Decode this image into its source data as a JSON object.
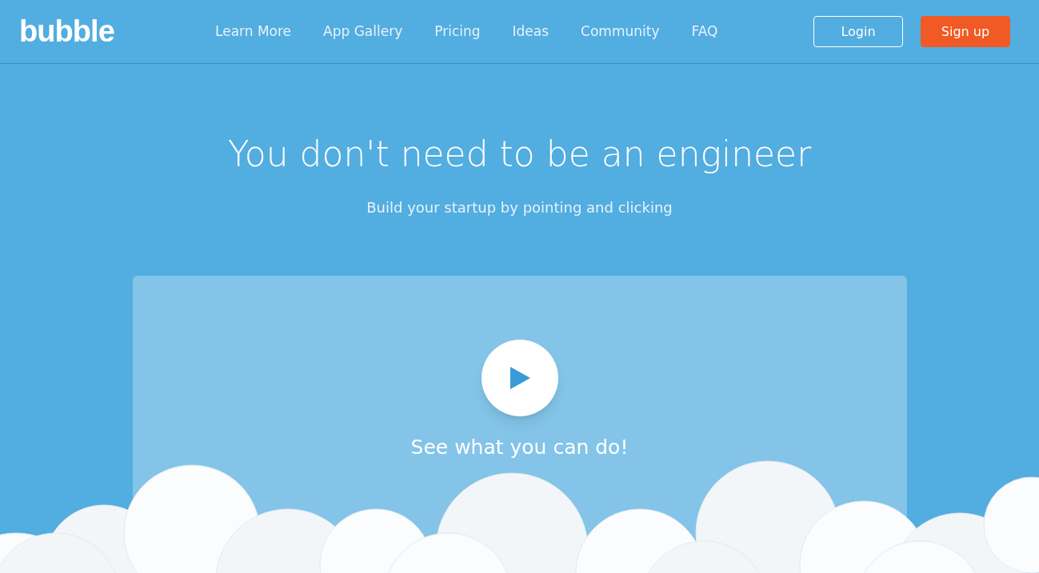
{
  "header": {
    "logo": "bubble",
    "nav": [
      {
        "label": "Learn More"
      },
      {
        "label": "App Gallery"
      },
      {
        "label": "Pricing"
      },
      {
        "label": "Ideas"
      },
      {
        "label": "Community"
      },
      {
        "label": "FAQ"
      }
    ],
    "buttons": [
      {
        "label": "Login",
        "kind": "outline"
      },
      {
        "label": "Sign up",
        "kind": "solid"
      }
    ]
  },
  "hero": {
    "title": "You don't need to be an engineer",
    "subtitle": "Build your startup by pointing and clicking"
  },
  "video": {
    "caption": "See what you can do!"
  }
}
